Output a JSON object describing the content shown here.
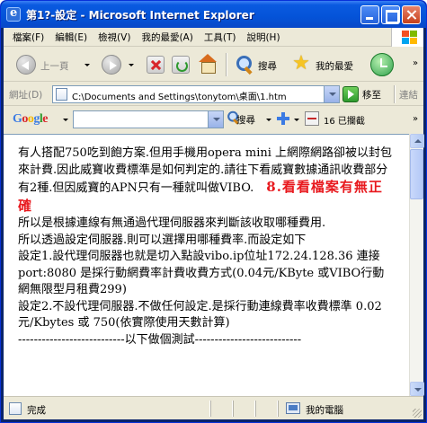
{
  "window": {
    "title": "第1?-設定 - Microsoft Internet Explorer"
  },
  "menubar": {
    "items": [
      "檔案(F)",
      "編輯(E)",
      "檢視(V)",
      "我的最愛(A)",
      "工具(T)",
      "說明(H)"
    ]
  },
  "toolbar": {
    "back_label": "上一頁",
    "search_label": "搜尋",
    "favorites_label": "我的最愛"
  },
  "addressbar": {
    "label": "網址(D)",
    "value": "C:\\Documents and Settings\\tonytom\\桌面\\1.htm",
    "go_label": "移至",
    "links_label": "連結"
  },
  "googlebar": {
    "logo": "Google",
    "search_label": "搜尋",
    "blocked_label": "16 已攔截"
  },
  "content": {
    "paragraph1": "有人搭配750吃到飽方案.但用手機用opera mini 上網際網路卻被以封包來計費.因此威寶收費標準是如何判定的.請往下看威寶數據通訊收費部分有2種.但因威寶的APN只有一種就叫做VIBO.",
    "highlight": "8.看看檔案有無正確",
    "paragraph2": "所以是根據連線有無通過代理伺服器來判斷該收取哪種費用.",
    "paragraph3": "所以透過設定伺服器.則可以選擇用哪種費率.而設定如下",
    "paragraph4": "設定1.設代理伺服器也就是切入點設vibo.ip位址172.24.128.36 連接port:8080 是採行動網費率計費收費方式(0.04元/KByte 或VIBO行動網無限型月租費299)",
    "paragraph5": "設定2.不設代理伺服器.不做任何設定.是採行動連線費率收費標準 0.02元/Kbytes 或 750(依實際使用天數計算)",
    "divider": "---------------------------以下做個測試---------------------------"
  },
  "statusbar": {
    "status": "完成",
    "zone": "我的電腦"
  },
  "colors": {
    "titlebar": "#0453d8",
    "chrome": "#ece9d8",
    "highlight": "#e8191e"
  }
}
